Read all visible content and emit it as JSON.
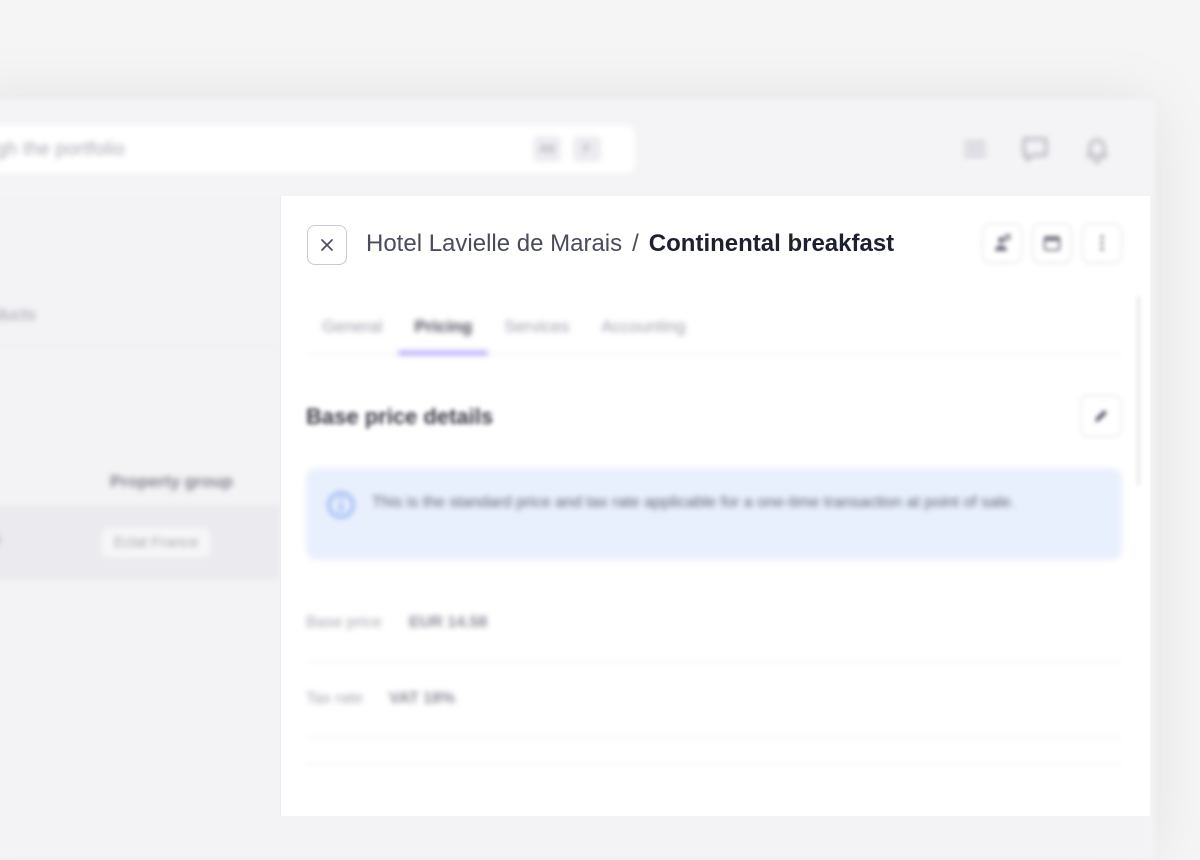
{
  "search": {
    "placeholder": "gh the portfolio",
    "shortcut_keys": [
      "Alt",
      "F"
    ]
  },
  "topbar": {
    "icons": [
      "menu-icon",
      "chat-icon",
      "bell-icon"
    ]
  },
  "sidebar": {
    "list_label": "roducts",
    "column_header": "Property group",
    "row_lead": "0",
    "row_tag": "Eclat France"
  },
  "drawer": {
    "breadcrumb": {
      "parent": "Hotel Lavielle de Marais",
      "separator": "/",
      "current": "Continental breakfast"
    },
    "header_actions": [
      "person-flag-icon",
      "calendar-icon",
      "more-vertical-icon"
    ],
    "tabs": [
      {
        "label": "General",
        "active": false
      },
      {
        "label": "Pricing",
        "active": true
      },
      {
        "label": "Services",
        "active": false
      },
      {
        "label": "Accounting",
        "active": false
      }
    ],
    "section": {
      "title": "Base price details"
    },
    "info": {
      "text": "This is the standard price and tax rate applicable for a one-time transaction at point of sale."
    },
    "fields": [
      {
        "label": "Base price",
        "value": "EUR 14.58"
      },
      {
        "label": "Tax rate",
        "value": "VAT 18%"
      }
    ]
  },
  "colors": {
    "tab_active_underline": "#a59cf6",
    "info_background": "#e9f0fd",
    "info_icon": "#6b95ee"
  }
}
